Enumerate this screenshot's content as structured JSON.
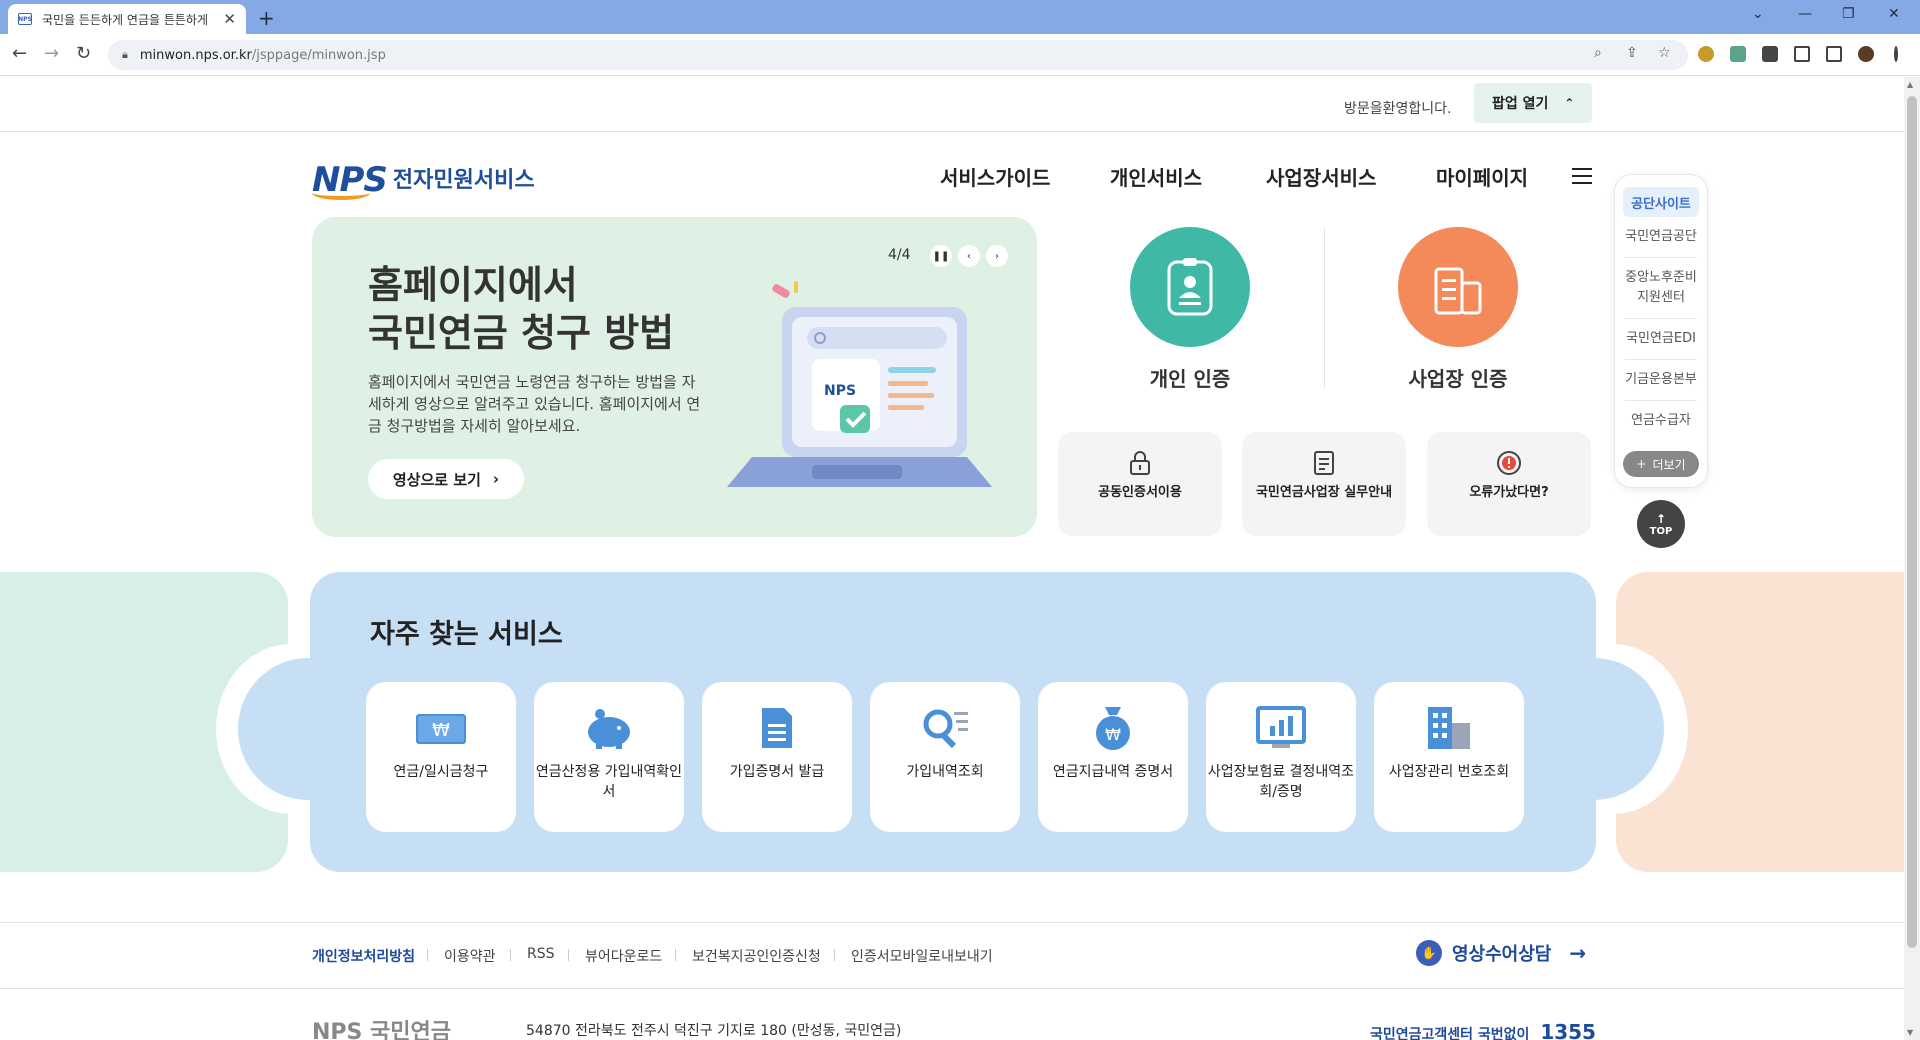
{
  "browser": {
    "tab_title": "국민을 든든하게 연금을 튼튼하게",
    "favicon_text": "NPS",
    "new_tab": "+",
    "url_host": "minwon.nps.or.kr",
    "url_path": "/jsppage/minwon.jsp"
  },
  "topbar": {
    "welcome": "방문을환영합니다.",
    "popup_label": "팝업 열기"
  },
  "header": {
    "logo_mark": "NPS",
    "logo_text": "전자민원서비스",
    "nav": [
      "서비스가이드",
      "개인서비스",
      "사업장서비스",
      "마이페이지"
    ]
  },
  "banner": {
    "title_line1": "홈페이지에서",
    "title_line2": "국민연금 청구 방법",
    "description": "홈페이지에서 국민연금 노령연금 청구하는 방법을 자세하게 영상으로 알려주고 있습니다. 홈페이지에서 연금 청구방법을 자세히 알아보세요.",
    "button": "영상으로 보기",
    "counter": "4/4",
    "illustration_logo": "NPS"
  },
  "cert": {
    "personal": "개인 인증",
    "business": "사업장 인증"
  },
  "quick_links": [
    {
      "label": "공동인증서이용",
      "icon": "lock-icon"
    },
    {
      "label": "국민연금사업장 실무안내",
      "icon": "document-icon"
    },
    {
      "label": "오류가났다면?",
      "icon": "alert-icon"
    }
  ],
  "side_panel": {
    "header": "공단사이트",
    "items": [
      "국민연금공단",
      "중앙노후준비 지원센터",
      "국민연금EDI",
      "기금운용본부",
      "연금수급자"
    ],
    "more": "더보기",
    "top": "TOP"
  },
  "services": {
    "title": "자주 찾는 서비스",
    "items": [
      {
        "label": "연금/일시금청구",
        "icon": "won-card-icon"
      },
      {
        "label": "연금산정용 가입내역확인서",
        "icon": "piggy-bank-icon"
      },
      {
        "label": "가입증명서 발급",
        "icon": "document-icon"
      },
      {
        "label": "가입내역조회",
        "icon": "search-list-icon"
      },
      {
        "label": "연금지급내역 증명서",
        "icon": "money-bag-icon"
      },
      {
        "label": "사업장보험료 결정내역조회/증명",
        "icon": "chart-board-icon"
      },
      {
        "label": "사업장관리 번호조회",
        "icon": "building-icon"
      }
    ],
    "won_symbol": "₩"
  },
  "footer": {
    "links": [
      "개인정보처리방침",
      "이용약관",
      "RSS",
      "뷰어다운로드",
      "보건복지공인인증신청",
      "인증서모바일로내보내기"
    ],
    "video_consult": "영상수어상담",
    "logo": "NPS 국민연금",
    "address": "54870 전라북도 전주시 덕진구 기지로 180 (만성동, 국민연금)",
    "callcenter_label": "국민연금고객센터  국번없이",
    "callcenter_number": "1355"
  },
  "colors": {
    "banner_bg": "#dff0e5",
    "personal_cert": "#3fb9a6",
    "business_cert": "#f48a5a",
    "services_bg": "#c7dff5",
    "brand_blue": "#1f4e9c"
  }
}
